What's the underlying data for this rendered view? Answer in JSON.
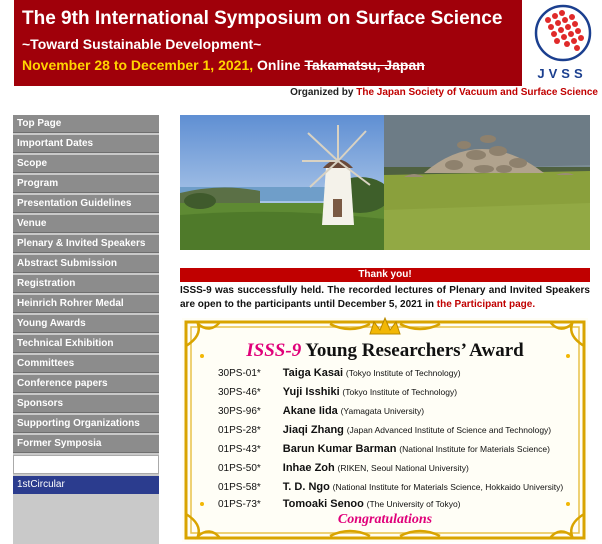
{
  "header": {
    "title": "The 9th International Symposium on Surface Science",
    "subtitle": "~Toward Sustainable Development~",
    "dates": "November 28 to December 1, 2021,",
    "mode": "Online",
    "venue_struck": "Takamatsu, Japan"
  },
  "logo": {
    "text": "JVSS"
  },
  "organized": {
    "prefix": "Organized by",
    "org": "The Japan Society of Vacuum and Surface Science"
  },
  "sidebar": {
    "items": [
      {
        "label": "Top Page"
      },
      {
        "label": "Important Dates"
      },
      {
        "label": "Scope"
      },
      {
        "label": "Program"
      },
      {
        "label": "Presentation Guidelines"
      },
      {
        "label": "Venue"
      },
      {
        "label": "Plenary & Invited Speakers"
      },
      {
        "label": "Abstract Submission"
      },
      {
        "label": "Registration"
      },
      {
        "label": "Heinrich Rohrer Medal"
      },
      {
        "label": "Young Awards"
      },
      {
        "label": "Technical Exhibition"
      },
      {
        "label": "Committees"
      },
      {
        "label": "Conference papers"
      },
      {
        "label": "Sponsors"
      },
      {
        "label": "Supporting Organizations"
      },
      {
        "label": "Former Symposia"
      }
    ],
    "circular": "1stCircular"
  },
  "thanks": {
    "bar": "Thank you!",
    "text": "ISSS-9 was successfully held. The recorded lectures of Plenary and Invited Speakers are open to the participants until December 5, 2021 in",
    "link": "the Participant page."
  },
  "award": {
    "title_prefix": "ISSS-9",
    "title_suffix": "Young Researchers’ Award",
    "winners": [
      {
        "code": "30PS-01*",
        "name": "Taiga Kasai",
        "aff": "(Tokyo Institute of Technology)"
      },
      {
        "code": "30PS-46*",
        "name": "Yuji Isshiki",
        "aff": "(Tokyo Institute of Technology)"
      },
      {
        "code": "30PS-96*",
        "name": "Akane Iida",
        "aff": "(Yamagata University)"
      },
      {
        "code": "01PS-28*",
        "name": "Jiaqi Zhang",
        "aff": "(Japan Advanced Institute of Science and Technology)"
      },
      {
        "code": "01PS-43*",
        "name": "Barun Kumar Barman",
        "aff": "(National Institute for Materials Science)"
      },
      {
        "code": "01PS-50*",
        "name": "Inhae Zoh",
        "aff": "(RIKEN, Seoul National University)"
      },
      {
        "code": "01PS-58*",
        "name": "T. D. Ngo",
        "aff": "(National Institute for Materials Science, Hokkaido University)"
      },
      {
        "code": "01PS-73*",
        "name": "Tomoaki Senoo",
        "aff": "(The University of Tokyo)"
      }
    ],
    "congrats": "Congratulations"
  },
  "colors": {
    "header_bg": "#a0000a",
    "accent_yellow": "#ffd400",
    "nav_bg": "#8c8c8c",
    "award_pink": "#e0007a",
    "gold": "#d9a400"
  }
}
